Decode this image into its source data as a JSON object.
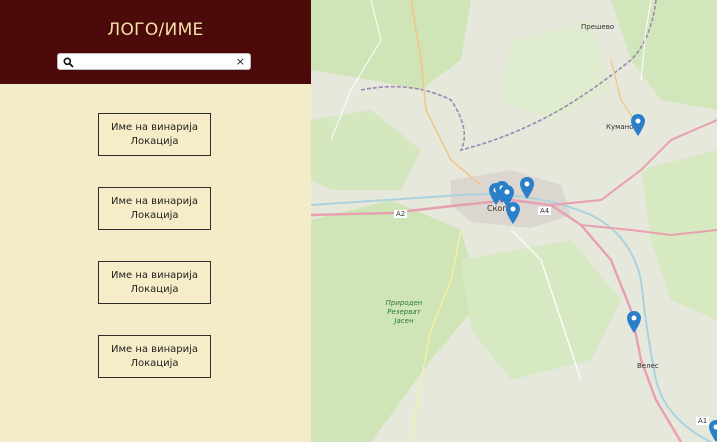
{
  "sidebar": {
    "logo": "ЛОГО/ИМЕ",
    "search": {
      "placeholder": "",
      "value": "",
      "clear_icon": "×"
    },
    "wineries": [
      {
        "name": "Име на винарија",
        "location": "Локација"
      },
      {
        "name": "Име на винарија",
        "location": "Локација"
      },
      {
        "name": "Име на винарија",
        "location": "Локација"
      },
      {
        "name": "Име на винарија",
        "location": "Локација"
      }
    ]
  },
  "map": {
    "labels": {
      "presevo": "Прешево",
      "kumanovo": "Куманово",
      "skopje": "Скопје",
      "veles": "Велес",
      "reserve": "Природен Резерват Јасен",
      "a2": "A2",
      "a4": "A4",
      "a1": "A1"
    },
    "colors": {
      "water": "#aad3df",
      "forest": "#cfe5b8",
      "road": "#e8a0b0",
      "pin": "#2a7fc9"
    }
  }
}
